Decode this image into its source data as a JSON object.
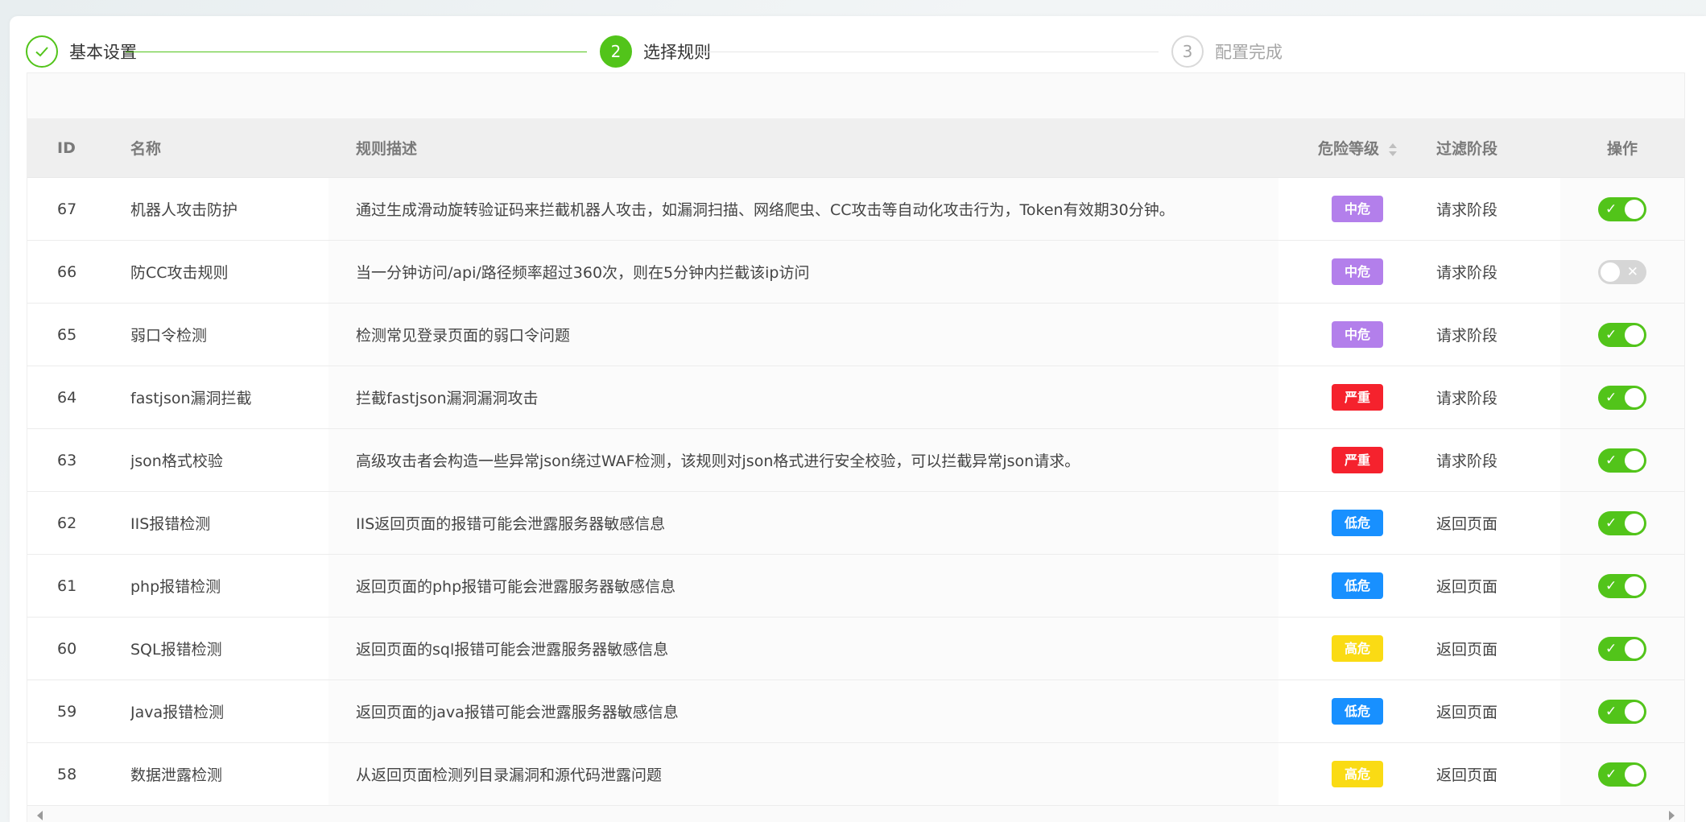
{
  "steps": [
    {
      "label": "基本设置",
      "status": "done",
      "icon": "check-icon"
    },
    {
      "label": "选择规则",
      "number": "2",
      "status": "active"
    },
    {
      "label": "配置完成",
      "number": "3",
      "status": "wait"
    }
  ],
  "table": {
    "headers": {
      "id": "ID",
      "name": "名称",
      "desc": "规则描述",
      "level": "危险等级",
      "phase": "过滤阶段",
      "action": "操作"
    },
    "rows": [
      {
        "id": "67",
        "name": "机器人攻击防护",
        "desc": "通过生成滑动旋转验证码来拦截机器人攻击，如漏洞扫描、网络爬虫、CC攻击等自动化攻击行为，Token有效期30分钟。",
        "level": "中危",
        "level_color": "#b37feb",
        "phase": "请求阶段",
        "enabled": true
      },
      {
        "id": "66",
        "name": "防CC攻击规则",
        "desc": "当一分钟访问/api/路径频率超过360次，则在5分钟内拦截该ip访问",
        "level": "中危",
        "level_color": "#b37feb",
        "phase": "请求阶段",
        "enabled": false
      },
      {
        "id": "65",
        "name": "弱口令检测",
        "desc": "检测常见登录页面的弱口令问题",
        "level": "中危",
        "level_color": "#b37feb",
        "phase": "请求阶段",
        "enabled": true
      },
      {
        "id": "64",
        "name": "fastjson漏洞拦截",
        "desc": "拦截fastjson漏洞漏洞攻击",
        "level": "严重",
        "level_color": "#f5222d",
        "phase": "请求阶段",
        "enabled": true
      },
      {
        "id": "63",
        "name": "json格式校验",
        "desc": "高级攻击者会构造一些异常json绕过WAF检测，该规则对json格式进行安全校验，可以拦截异常json请求。",
        "level": "严重",
        "level_color": "#f5222d",
        "phase": "请求阶段",
        "enabled": true
      },
      {
        "id": "62",
        "name": "IIS报错检测",
        "desc": "IIS返回页面的报错可能会泄露服务器敏感信息",
        "level": "低危",
        "level_color": "#1890ff",
        "phase": "返回页面",
        "enabled": true
      },
      {
        "id": "61",
        "name": "php报错检测",
        "desc": "返回页面的php报错可能会泄露服务器敏感信息",
        "level": "低危",
        "level_color": "#1890ff",
        "phase": "返回页面",
        "enabled": true
      },
      {
        "id": "60",
        "name": "SQL报错检测",
        "desc": "返回页面的sql报错可能会泄露服务器敏感信息",
        "level": "高危",
        "level_color": "#fadb14",
        "phase": "返回页面",
        "enabled": true
      },
      {
        "id": "59",
        "name": "Java报错检测",
        "desc": "返回页面的java报错可能会泄露服务器敏感信息",
        "level": "低危",
        "level_color": "#1890ff",
        "phase": "返回页面",
        "enabled": true
      },
      {
        "id": "58",
        "name": "数据泄露检测",
        "desc": "从返回页面检测列目录漏洞和源代码泄露问题",
        "level": "高危",
        "level_color": "#fadb14",
        "phase": "返回页面",
        "enabled": true
      }
    ]
  },
  "colors": {
    "accent": "#52c41a",
    "toggle_off": "#d6d6d6"
  }
}
